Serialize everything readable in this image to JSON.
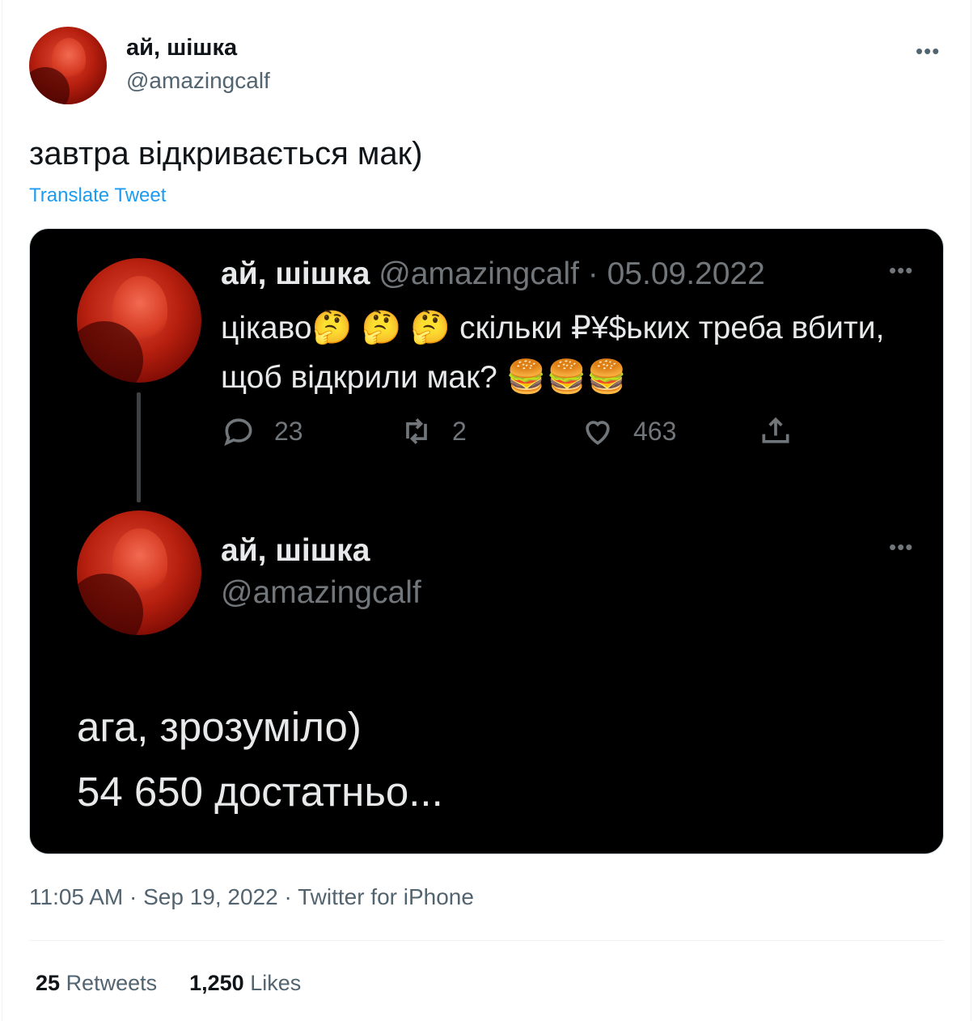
{
  "header": {
    "display_name": "ай, шішка",
    "handle": "@amazingcalf",
    "more_label": "•••"
  },
  "tweet": {
    "text": "завтра відкривається мак)",
    "translate_label": "Translate Tweet"
  },
  "quoted": {
    "first": {
      "display_name": "ай, шішка",
      "handle_date": "@amazingcalf · 05.09.2022",
      "text_a": "цікаво",
      "emoji_think": "🤔 🤔 🤔",
      "text_b": " скільки ₽¥$ьких треба вбити, щоб відкрили мак?",
      "emoji_burger": "🍔🍔🍔",
      "replies": "23",
      "retweets": "2",
      "likes": "463",
      "more_label": "•••"
    },
    "second": {
      "display_name": "ай, шішка",
      "handle": "@amazingcalf",
      "line1": "ага, зрозуміло)",
      "line2": "54 650 достатньо...",
      "more_label": "•••"
    }
  },
  "meta": {
    "time": "11:05 AM · Sep 19, 2022 · Twitter for iPhone"
  },
  "stats": {
    "retweets_count": "25",
    "retweets_label": "Retweets",
    "likes_count": "1,250",
    "likes_label": "Likes"
  },
  "colors": {
    "link": "#1d9bf0",
    "secondary": "#536471",
    "media_bg": "#000000"
  }
}
